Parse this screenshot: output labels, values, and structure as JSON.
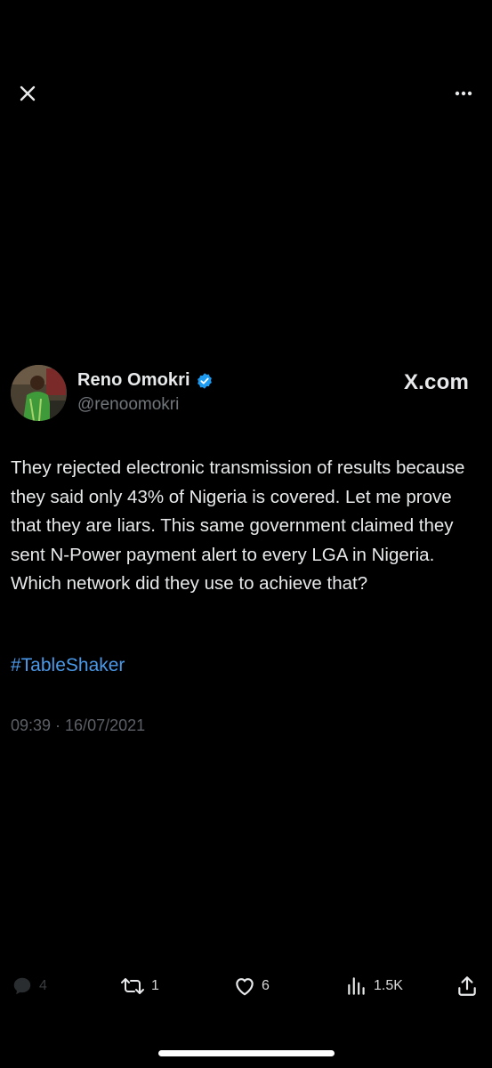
{
  "header": {
    "close_icon": "close-icon",
    "more_icon": "more-horizontal-icon"
  },
  "tweet": {
    "author_name": "Reno Omokri",
    "verified_icon": "verified-badge-icon",
    "handle": "@renoomokri",
    "brand": "X.com",
    "text": "They rejected electronic transmission of results because they said only 43% of Nigeria is covered. Let me prove that they are liars. This same government claimed they sent N-Power payment alert to every LGA in Nigeria. Which network did they use to achieve that?",
    "hashtag": "#TableShaker",
    "timestamp": "09:39 · 16/07/2021"
  },
  "actions": {
    "reply": {
      "icon": "reply-icon",
      "count": "4"
    },
    "retweet": {
      "icon": "retweet-icon",
      "count": "1"
    },
    "like": {
      "icon": "heart-icon",
      "count": "6"
    },
    "views": {
      "icon": "views-icon",
      "count": "1.5K"
    },
    "share": {
      "icon": "share-icon"
    }
  },
  "colors": {
    "background": "#000000",
    "primary_text": "#e7e9ea",
    "secondary_text": "#71767b",
    "link": "#4a99e9",
    "verified": "#1d9bf0"
  }
}
